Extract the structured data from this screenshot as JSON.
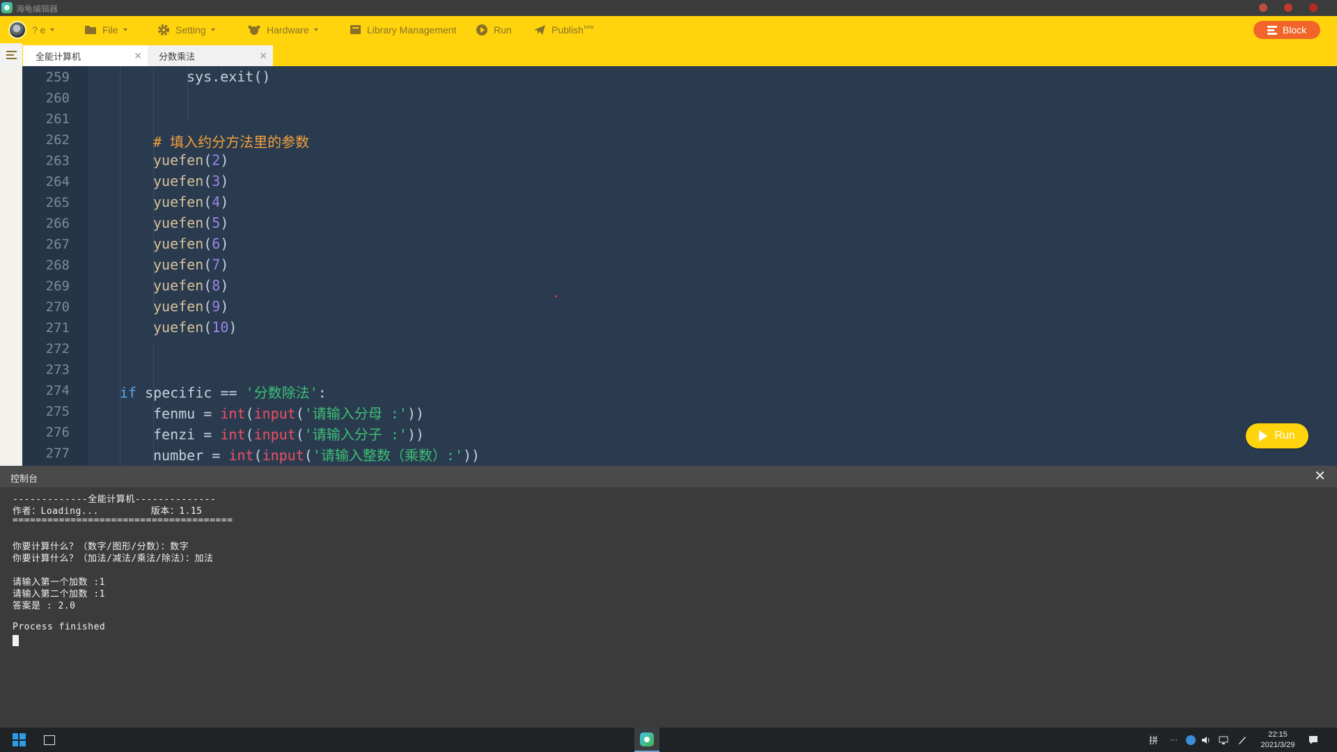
{
  "window": {
    "title": "海龟编辑器"
  },
  "toolbar": {
    "user": {
      "name": "? e"
    },
    "items": [
      {
        "label": "File",
        "icon": "folder-icon"
      },
      {
        "label": "Setting",
        "icon": "gear-icon"
      },
      {
        "label": "Hardware",
        "icon": "hardware-icon"
      },
      {
        "label": "Library Management",
        "icon": "library-icon"
      },
      {
        "label": "Run",
        "icon": "play-icon"
      },
      {
        "label": "Publish",
        "icon": "paper-plane-icon",
        "badge": "beta"
      }
    ],
    "block_button": "Block"
  },
  "tabs": [
    {
      "label": "全能计算机",
      "active": true
    },
    {
      "label": "分数乘法",
      "active": false
    }
  ],
  "editor": {
    "lines": [
      {
        "num": "259",
        "indent": 3,
        "tokens": [
          [
            "plain",
            "sys.exit()"
          ]
        ]
      },
      {
        "num": "260",
        "indent": 0,
        "tokens": []
      },
      {
        "num": "261",
        "indent": 0,
        "tokens": []
      },
      {
        "num": "262",
        "indent": 2,
        "tokens": [
          [
            "comment",
            "# 填入约分方法里的参数"
          ]
        ]
      },
      {
        "num": "263",
        "indent": 2,
        "tokens": [
          [
            "name",
            "yuefen"
          ],
          [
            "plain",
            "("
          ],
          [
            "num",
            "2"
          ],
          [
            "plain",
            ")"
          ]
        ]
      },
      {
        "num": "264",
        "indent": 2,
        "tokens": [
          [
            "name",
            "yuefen"
          ],
          [
            "plain",
            "("
          ],
          [
            "num",
            "3"
          ],
          [
            "plain",
            ")"
          ]
        ]
      },
      {
        "num": "265",
        "indent": 2,
        "tokens": [
          [
            "name",
            "yuefen"
          ],
          [
            "plain",
            "("
          ],
          [
            "num",
            "4"
          ],
          [
            "plain",
            ")"
          ]
        ]
      },
      {
        "num": "266",
        "indent": 2,
        "tokens": [
          [
            "name",
            "yuefen"
          ],
          [
            "plain",
            "("
          ],
          [
            "num",
            "5"
          ],
          [
            "plain",
            ")"
          ]
        ]
      },
      {
        "num": "267",
        "indent": 2,
        "tokens": [
          [
            "name",
            "yuefen"
          ],
          [
            "plain",
            "("
          ],
          [
            "num",
            "6"
          ],
          [
            "plain",
            ")"
          ]
        ]
      },
      {
        "num": "268",
        "indent": 2,
        "tokens": [
          [
            "name",
            "yuefen"
          ],
          [
            "plain",
            "("
          ],
          [
            "num",
            "7"
          ],
          [
            "plain",
            ")"
          ]
        ]
      },
      {
        "num": "269",
        "indent": 2,
        "tokens": [
          [
            "name",
            "yuefen"
          ],
          [
            "plain",
            "("
          ],
          [
            "num",
            "8"
          ],
          [
            "plain",
            ")"
          ]
        ]
      },
      {
        "num": "270",
        "indent": 2,
        "tokens": [
          [
            "name",
            "yuefen"
          ],
          [
            "plain",
            "("
          ],
          [
            "num",
            "9"
          ],
          [
            "plain",
            ")"
          ]
        ]
      },
      {
        "num": "271",
        "indent": 2,
        "tokens": [
          [
            "name",
            "yuefen"
          ],
          [
            "plain",
            "("
          ],
          [
            "num",
            "10"
          ],
          [
            "plain",
            ")"
          ]
        ]
      },
      {
        "num": "272",
        "indent": 0,
        "tokens": []
      },
      {
        "num": "273",
        "indent": 0,
        "tokens": []
      },
      {
        "num": "274",
        "indent": 1,
        "tokens": [
          [
            "kw",
            "if"
          ],
          [
            "plain",
            " specific == "
          ],
          [
            "str",
            "'分数除法'"
          ],
          [
            "plain",
            ":"
          ]
        ]
      },
      {
        "num": "275",
        "indent": 2,
        "tokens": [
          [
            "plain",
            "fenmu = "
          ],
          [
            "builtin",
            "int"
          ],
          [
            "plain",
            "("
          ],
          [
            "builtin",
            "input"
          ],
          [
            "plain",
            "("
          ],
          [
            "str",
            "'请输入分母 :'"
          ],
          [
            "plain",
            "))"
          ]
        ]
      },
      {
        "num": "276",
        "indent": 2,
        "tokens": [
          [
            "plain",
            "fenzi = "
          ],
          [
            "builtin",
            "int"
          ],
          [
            "plain",
            "("
          ],
          [
            "builtin",
            "input"
          ],
          [
            "plain",
            "("
          ],
          [
            "str",
            "'请输入分子 :'"
          ],
          [
            "plain",
            "))"
          ]
        ]
      },
      {
        "num": "277",
        "indent": 2,
        "tokens": [
          [
            "plain",
            "number = "
          ],
          [
            "builtin",
            "int"
          ],
          [
            "plain",
            "("
          ],
          [
            "builtin",
            "input"
          ],
          [
            "plain",
            "("
          ],
          [
            "str",
            "'请输入整数（乘数）:'"
          ],
          [
            "plain",
            "))"
          ]
        ]
      }
    ],
    "run_button": "Run"
  },
  "console": {
    "title": "控制台",
    "lines": [
      "-------------全能计算机--------------",
      "作者：Loading...         版本：1.15",
      "======================================",
      "",
      "你要计算什么？（数字/图形/分数）：数字",
      "你要计算什么？（加法/减法/乘法/除法）：加法",
      "",
      "请输入第一个加数 :1",
      "请输入第二个加数 :1",
      "答案是 : 2.0",
      "",
      "Process finished"
    ]
  },
  "taskbar": {
    "clock_time": "22:15",
    "clock_date": "2021/3/29",
    "tray_ime": "拼",
    "tray_more": "···"
  },
  "colors": {
    "accent": "#ffd40c",
    "block_button": "#f1652a",
    "editor_bg": "#2a3b50",
    "console_bg": "#3b3b3b"
  }
}
